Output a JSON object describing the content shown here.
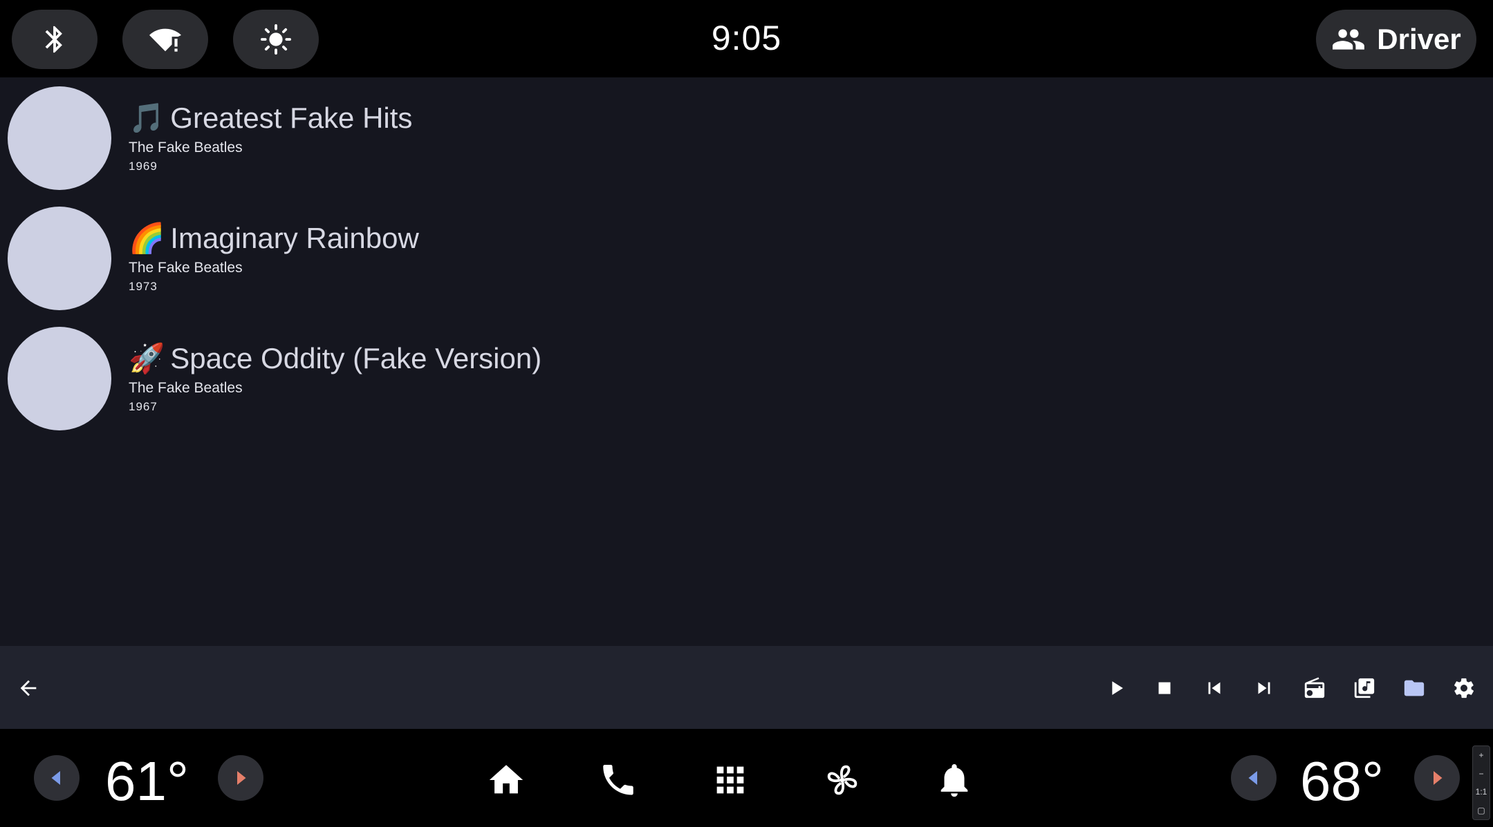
{
  "status_bar": {
    "clock": "9:05",
    "profile_label": "Driver",
    "quick_settings": [
      "bluetooth-icon",
      "wifi-alert-icon",
      "brightness-icon"
    ]
  },
  "albums": [
    {
      "emoji": "🎵",
      "title": "Greatest Fake Hits",
      "artist": "The Fake Beatles",
      "year": "1969"
    },
    {
      "emoji": "🌈",
      "title": "Imaginary Rainbow",
      "artist": "The Fake Beatles",
      "year": "1973"
    },
    {
      "emoji": "🚀",
      "title": "Space Oddity (Fake Version)",
      "artist": "The Fake Beatles",
      "year": "1967"
    }
  ],
  "control_bar": {
    "buttons": [
      "back-arrow-icon",
      "play-icon",
      "stop-icon",
      "skip-previous-icon",
      "skip-next-icon",
      "radio-icon",
      "library-music-icon",
      "folder-icon",
      "settings-icon"
    ]
  },
  "nav_bar": {
    "left_temp": "61°",
    "right_temp": "68°",
    "icons": [
      "home-icon",
      "phone-icon",
      "app-grid-icon",
      "fan-icon",
      "bell-icon"
    ],
    "zoom": [
      "+",
      "−",
      "1:1",
      "▢"
    ]
  },
  "colors": {
    "content_bg": "#15161f",
    "control_bar_bg": "#21232e",
    "album_art": "#cdd0e3",
    "accent": "#b9c6f4",
    "temp_left_arrow": "#7b9be8",
    "temp_right_arrow": "#e57f6a"
  }
}
